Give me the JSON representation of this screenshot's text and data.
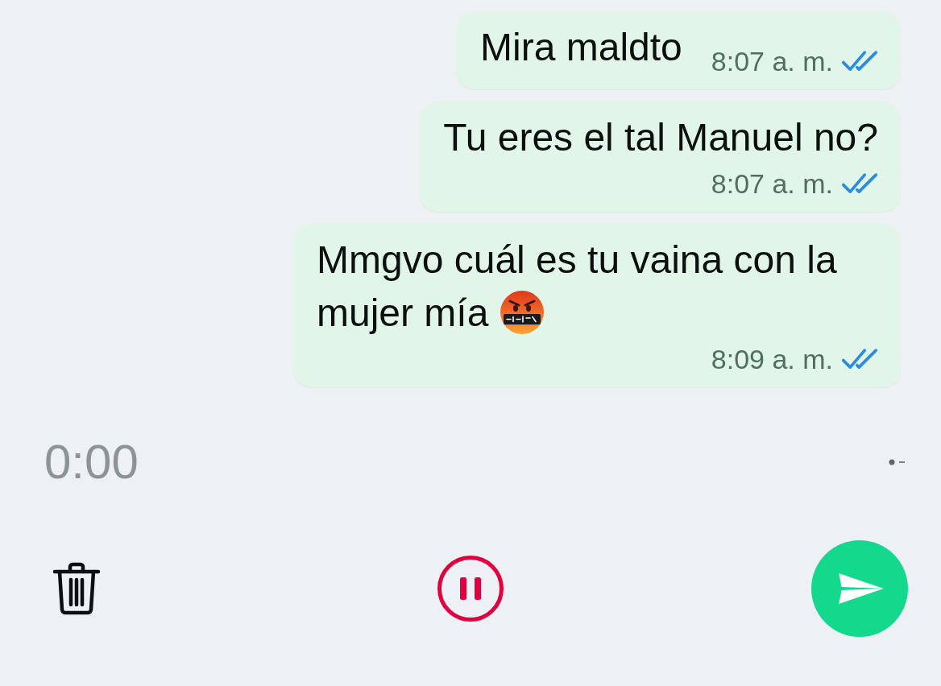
{
  "messages": [
    {
      "text": "Mira maldto",
      "emoji": false,
      "time": "8:07 a. m.",
      "read": true,
      "kind": "inline"
    },
    {
      "text": "Tu eres el tal Manuel no?",
      "emoji": false,
      "time": "8:07 a. m.",
      "read": true,
      "kind": "stacked"
    },
    {
      "text": "Mmgvo cuál es tu vaina con la mujer mía",
      "emoji": true,
      "time": "8:09 a. m.",
      "read": true,
      "kind": "stacked"
    }
  ],
  "recorder": {
    "elapsed": "0:00",
    "recording": true
  }
}
